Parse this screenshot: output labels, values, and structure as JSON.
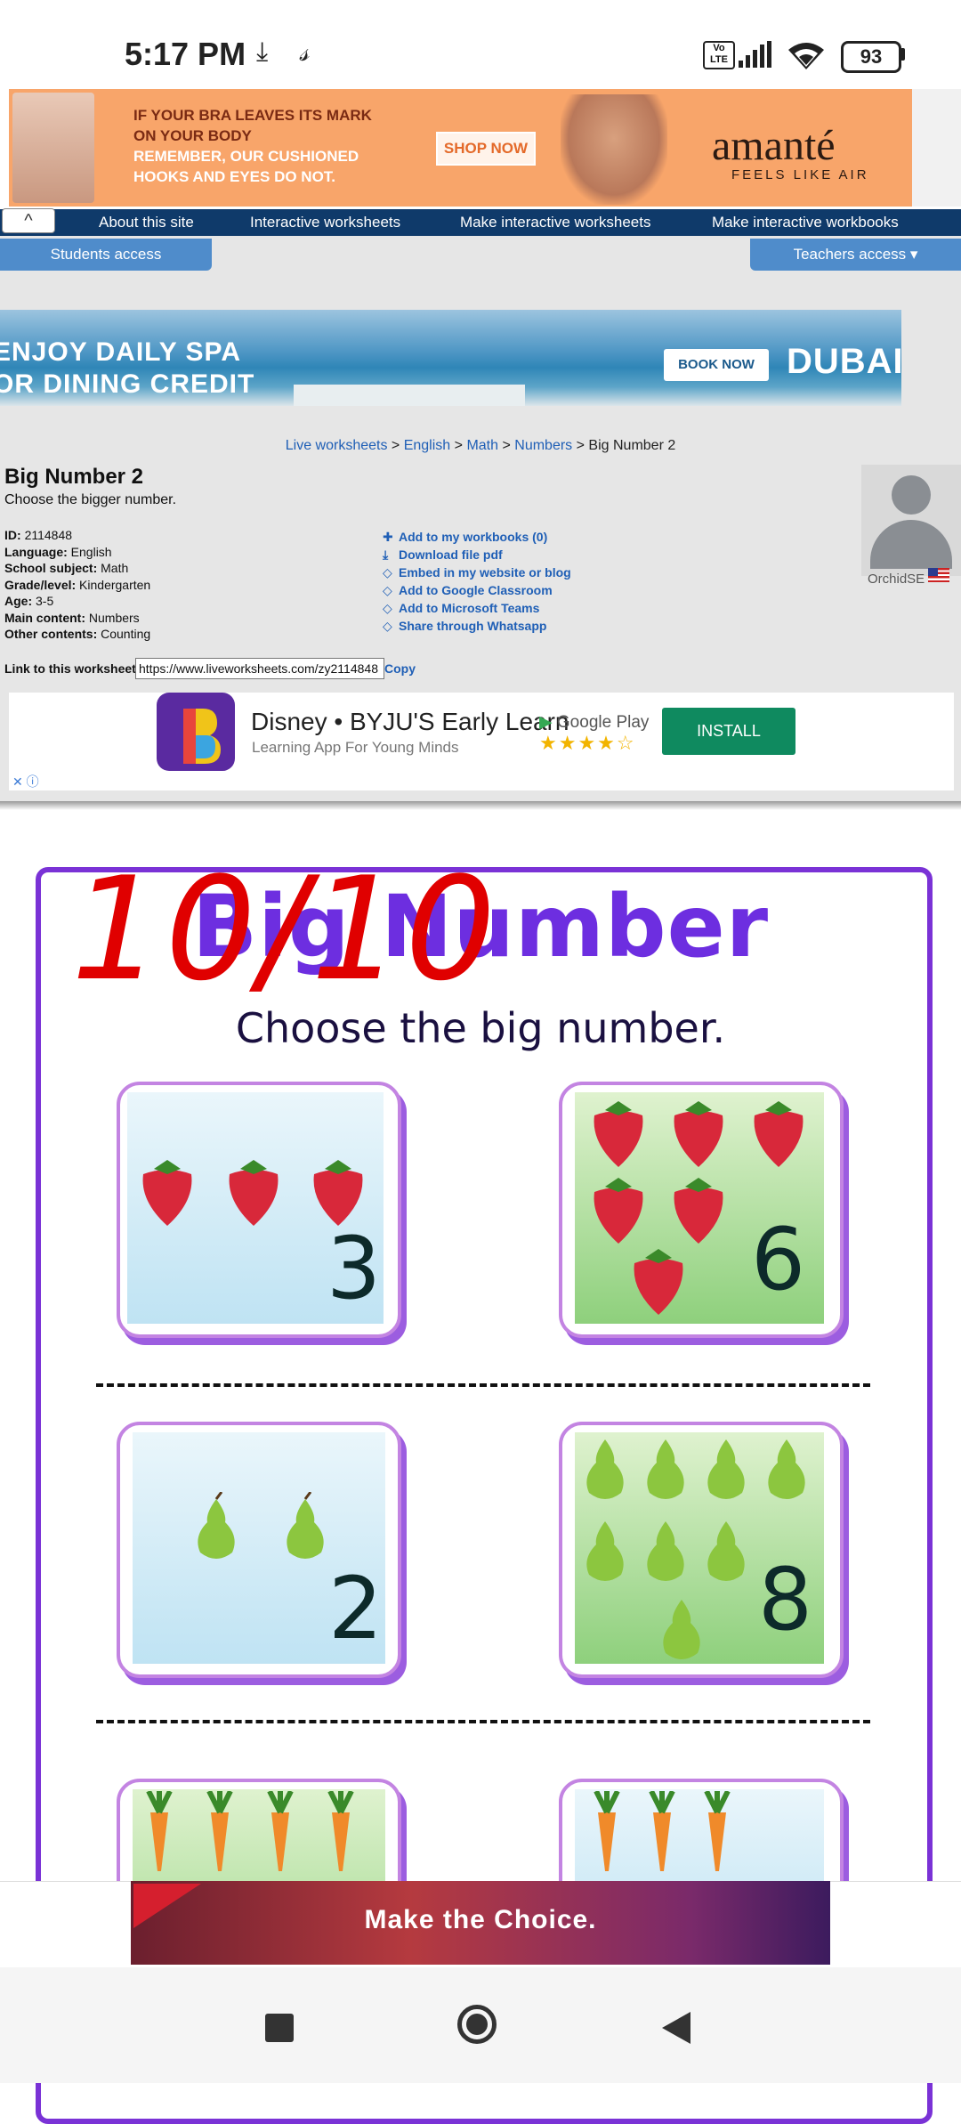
{
  "status_bar": {
    "time": "5:17 PM",
    "battery": "93",
    "icons": [
      "download-icon",
      "app-icon",
      "volte-icon",
      "signal-icon",
      "wifi-icon",
      "battery-icon"
    ]
  },
  "ad_top": {
    "line1": "IF YOUR BRA LEAVES ITS MARK",
    "line2": "ON YOUR BODY",
    "line3": "REMEMBER, OUR CUSHIONED",
    "line4": "HOOKS AND EYES DO NOT.",
    "button": "SHOP NOW",
    "brand": "amanté",
    "tagline": "FEELS LIKE AIR"
  },
  "nav": {
    "collapse_icon": "^",
    "items": [
      "About this site",
      "Interactive worksheets",
      "Make interactive worksheets",
      "Make interactive workbooks"
    ],
    "students_access": "Students access",
    "teachers_access": "Teachers access ▾"
  },
  "ad_dubai": {
    "line1": "ENJOY DAILY SPA",
    "line2": "OR DINING CREDIT",
    "button": "BOOK NOW",
    "logo": "DUBAI"
  },
  "breadcrumb": {
    "items": [
      "Live worksheets",
      "English",
      "Math",
      "Numbers"
    ],
    "separator": ">",
    "current": "Big Number 2"
  },
  "worksheet_info": {
    "title": "Big Number 2",
    "subtitle": "Choose the bigger number.",
    "meta": [
      {
        "label": "ID:",
        "value": "2114848"
      },
      {
        "label": "Language:",
        "value": "English"
      },
      {
        "label": "School subject:",
        "value": "Math"
      },
      {
        "label": "Grade/level:",
        "value": "Kindergarten"
      },
      {
        "label": "Age:",
        "value": "3-5"
      },
      {
        "label": "Main content:",
        "value": "Numbers"
      },
      {
        "label": "Other contents:",
        "value": "Counting"
      }
    ],
    "actions": [
      "Add to my workbooks (0)",
      "Download file pdf",
      "Embed in my website or blog",
      "Add to Google Classroom",
      "Add to Microsoft Teams",
      "Share through Whatsapp"
    ],
    "author": "OrchidSE",
    "link_label": "Link to this worksheet:",
    "link_value": "https://www.liveworksheets.com/zy2114848",
    "copy": "Copy"
  },
  "ad_disney": {
    "title": "Disney • BYJU'S Early Learn",
    "subtitle": "Learning App For Young Minds",
    "store": "Google Play",
    "stars": "★★★★☆",
    "button": "INSTALL"
  },
  "worksheet": {
    "score": "10/10",
    "title": "Big Number",
    "instruction": "Choose the big number.",
    "rows": [
      {
        "left": "3",
        "right": "6",
        "item": "strawberry"
      },
      {
        "left": "2",
        "right": "8",
        "item": "pear"
      },
      {
        "left": "",
        "right": "",
        "item": "carrot"
      }
    ]
  },
  "ad_bottom": {
    "text": "Make the Choice."
  },
  "colors": {
    "accent": "#7a32d6",
    "nav": "#0f3a6a",
    "button_blue": "#4f8ccb",
    "link": "#1f5fb6",
    "score_red": "#e00000"
  }
}
